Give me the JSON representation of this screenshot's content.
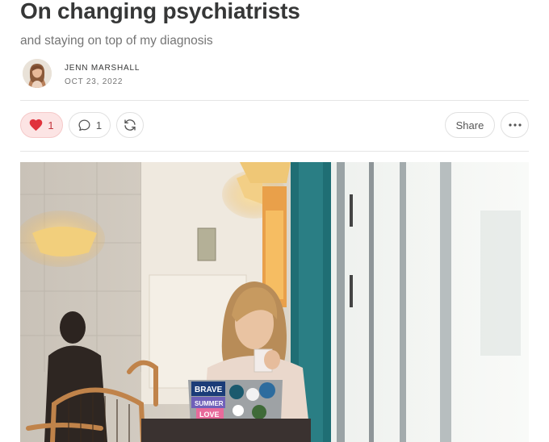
{
  "post": {
    "title": "On changing psychiatrists",
    "subtitle": "and staying on top of my diagnosis",
    "author": "JENN MARSHALL",
    "date": "OCT 23, 2022"
  },
  "actions": {
    "like_count": "1",
    "comment_count": "1",
    "share_label": "Share"
  },
  "hero_image": {
    "laptop_stickers": [
      "BRAVE",
      "SUMMER",
      "LOVE"
    ]
  },
  "icons": {
    "like": "heart-icon",
    "comment": "comment-bubble-icon",
    "restack": "restack-icon",
    "more": "ellipsis-icon"
  },
  "colors": {
    "like_fill": "#e0323c",
    "like_bg": "#fce4e4",
    "text": "#363737",
    "muted": "#757575"
  }
}
